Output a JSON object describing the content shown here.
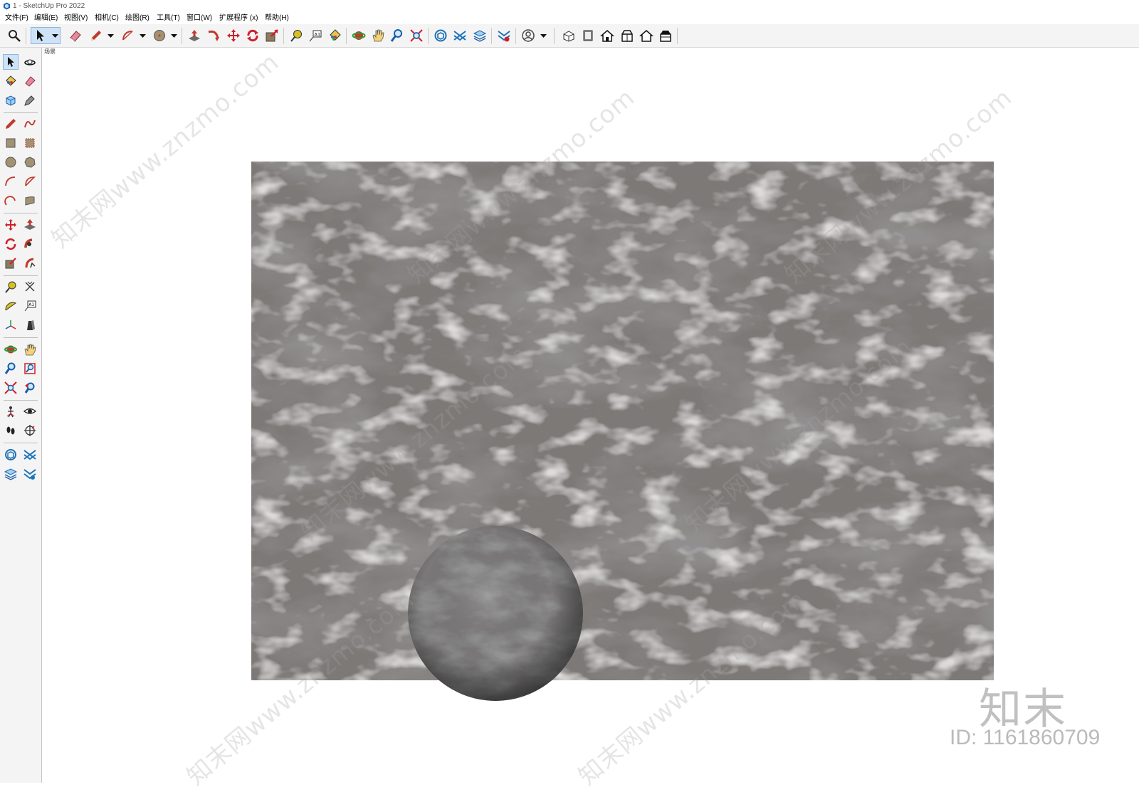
{
  "window": {
    "title": "1 - SketchUp Pro 2022"
  },
  "menu": [
    "文件(F)",
    "编辑(E)",
    "视图(V)",
    "相机(C)",
    "绘图(R)",
    "工具(T)",
    "窗口(W)",
    "扩展程序 (x)",
    "帮助(H)"
  ],
  "scene": {
    "label": "场景"
  },
  "watermark": {
    "site_text": "知末网www.znzmo.com",
    "logo": "知末",
    "id": "ID: 1161860709"
  },
  "colors": {
    "toolbar_bg": "#f4f4f4",
    "selected_bg": "#cfe3f7",
    "stone": "#7d7977"
  },
  "toolbar_icons": [
    "zoom-icon",
    "select-icon",
    "eraser-icon",
    "pencil-icon",
    "arc-icon",
    "circle-icon",
    "push-pull-icon",
    "follow-me-icon",
    "move-icon",
    "rotate-icon",
    "scale-icon",
    "tape-measure-icon",
    "text-icon",
    "paint-bucket-icon",
    "orbit-icon",
    "pan-icon",
    "zoom-window-icon",
    "zoom-extents-icon",
    "3d-warehouse-icon",
    "extension-warehouse-icon",
    "layout-icon",
    "extension-manager-icon",
    "account-icon",
    "iso-view-icon",
    "top-view-icon",
    "front-view-icon",
    "right-view-icon",
    "back-view-icon",
    "left-view-icon"
  ],
  "left_tools": [
    "select-icon",
    "orbit-icon",
    "paint-bucket-icon",
    "eraser-icon",
    "make-component-icon",
    "tag-icon",
    "line-icon",
    "freehand-icon",
    "rectangle-icon",
    "rotated-rectangle-icon",
    "circle-icon",
    "polygon-icon",
    "arc-icon",
    "pie-icon",
    "2point-arc-icon",
    "3point-arc-icon",
    "move-icon",
    "push-pull-icon",
    "rotate-icon",
    "follow-me-icon",
    "scale-icon",
    "offset-icon",
    "tape-measure-icon",
    "dimension-icon",
    "protractor-icon",
    "text-icon",
    "axes-icon",
    "3d-text-icon",
    "orbit-icon",
    "pan-icon",
    "zoom-icon",
    "zoom-window-icon",
    "zoom-extents-icon",
    "previous-view-icon",
    "position-camera-icon",
    "look-around-icon",
    "walk-icon",
    "section-plane-icon",
    "3d-warehouse-icon",
    "extension-warehouse-icon",
    "layout-icon",
    "extension-manager-icon"
  ]
}
